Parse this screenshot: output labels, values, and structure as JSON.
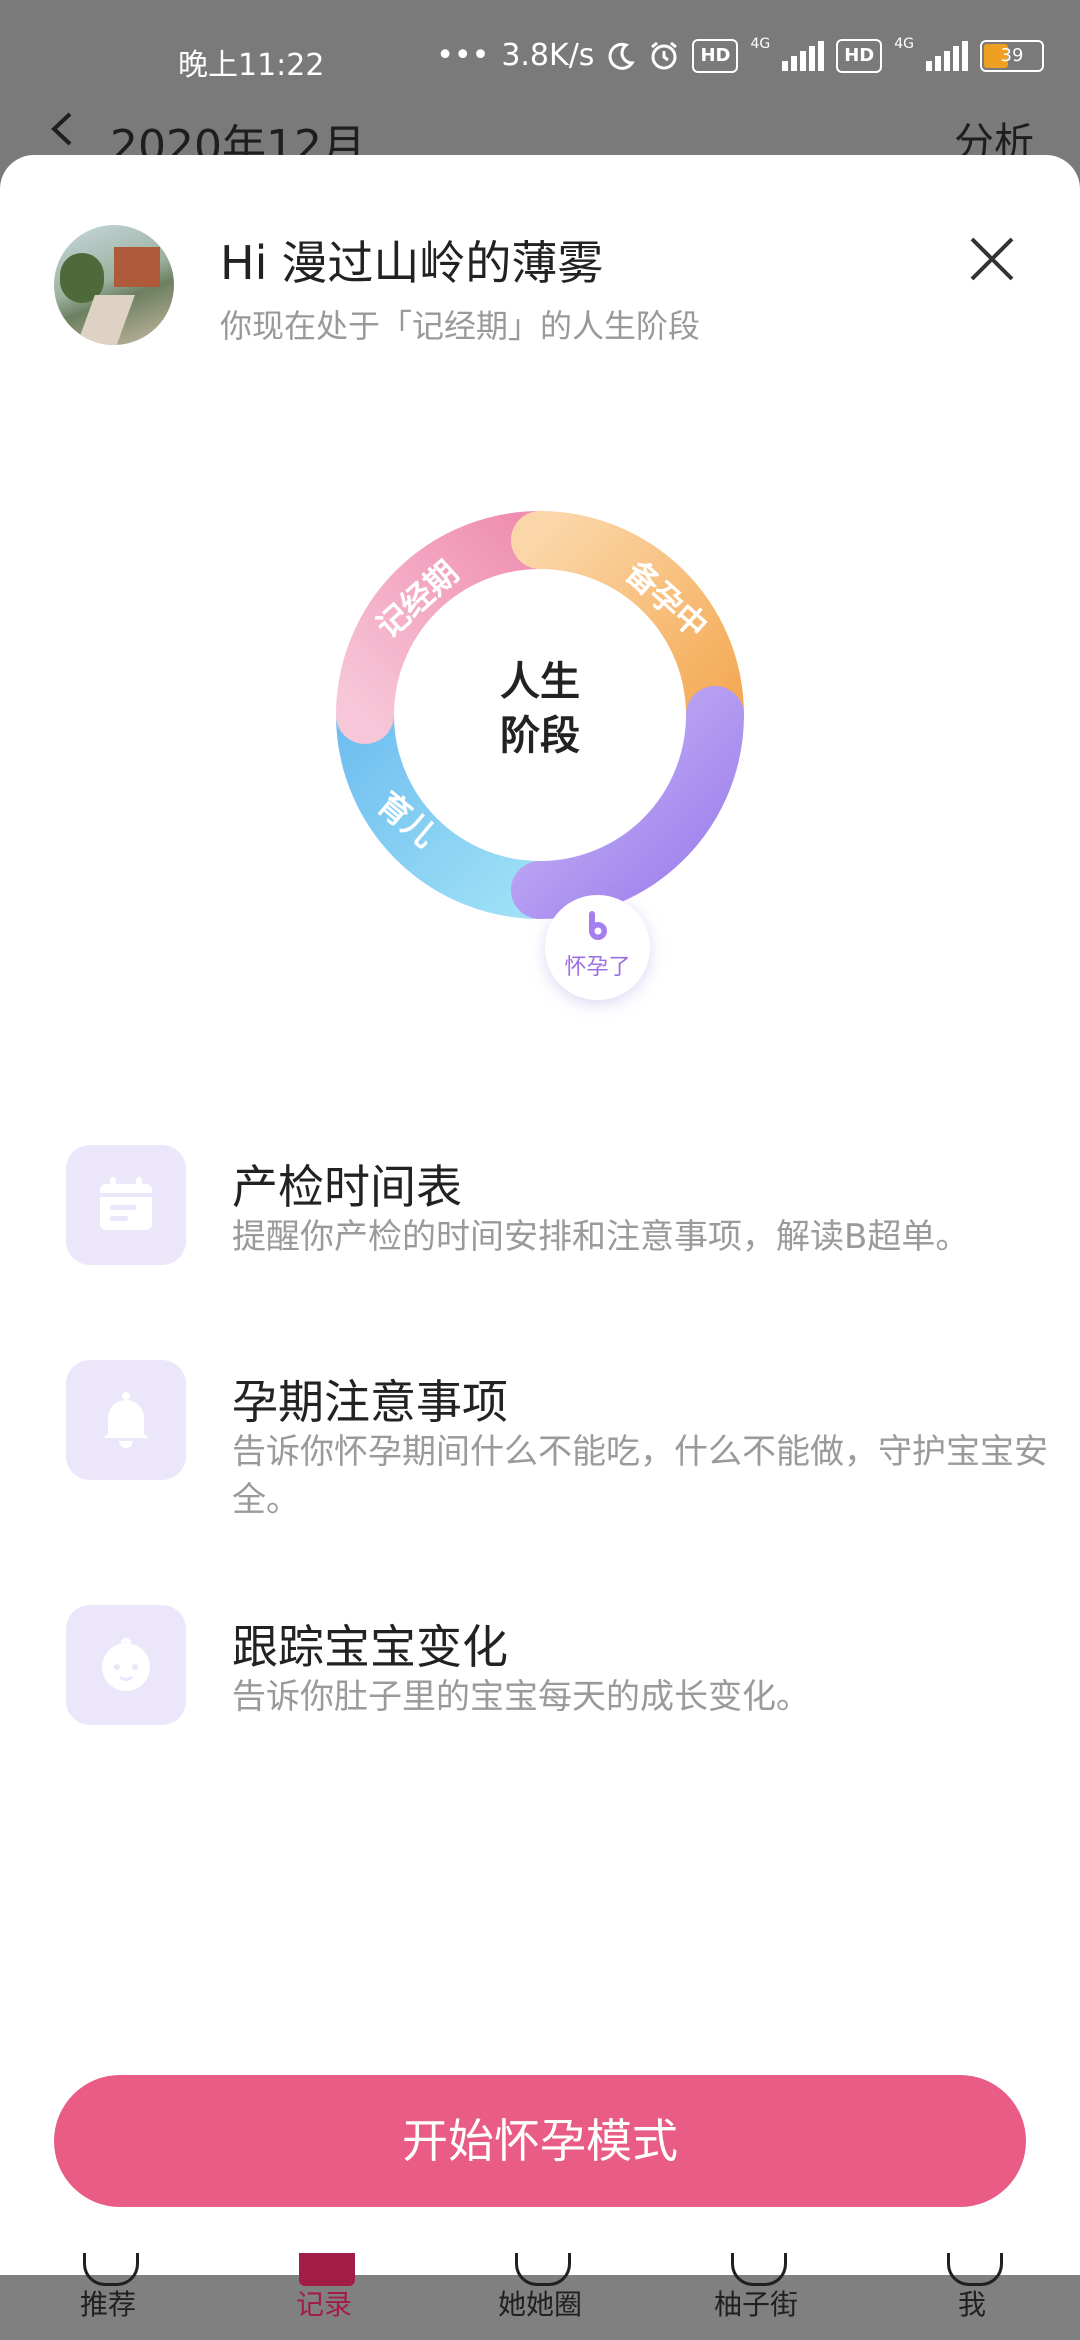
{
  "status_bar": {
    "time": "晚上11:22",
    "network_speed": "3.8K/s",
    "chip_1": "HD",
    "chip_2": "HD",
    "network_1": "4G",
    "network_2": "4G",
    "battery": "39"
  },
  "header": {
    "title": "2020年12月",
    "analysis_label": "分析"
  },
  "profile": {
    "greeting_prefix": "Hi",
    "username": "漫过山岭的薄雾",
    "stage_text": "你现在处于「记经期」的人生阶段"
  },
  "ring": {
    "center_label_line1": "人生",
    "center_label_line2": "阶段",
    "segments": {
      "period": "记经期",
      "preparing": "备孕中",
      "parenting": "育儿",
      "pregnant": "怀孕了"
    },
    "colors": {
      "period": "#f29cb8",
      "preparing": "#f6b870",
      "pregnant": "#a98ef0",
      "parenting": "#6cc4f0"
    }
  },
  "features": [
    {
      "icon": "calendar-icon",
      "title": "产检时间表",
      "desc": "提醒你产检的时间安排和注意事项，解读B超单。"
    },
    {
      "icon": "bell-icon",
      "title": "孕期注意事项",
      "desc": "告诉你怀孕期间什么不能吃，什么不能做，守护宝宝安全。"
    },
    {
      "icon": "baby-face-icon",
      "title": "跟踪宝宝变化",
      "desc": "告诉你肚子里的宝宝每天的成长变化。"
    }
  ],
  "start_button_label": "开始怀孕模式",
  "bottom_nav": [
    {
      "label": "推荐",
      "active": false
    },
    {
      "label": "记录",
      "active": true
    },
    {
      "label": "她她圈",
      "active": false
    },
    {
      "label": "柚子街",
      "active": false
    },
    {
      "label": "我",
      "active": false
    }
  ],
  "accent_color": "#e85c86",
  "icon_tile_color": "#ece6fb"
}
